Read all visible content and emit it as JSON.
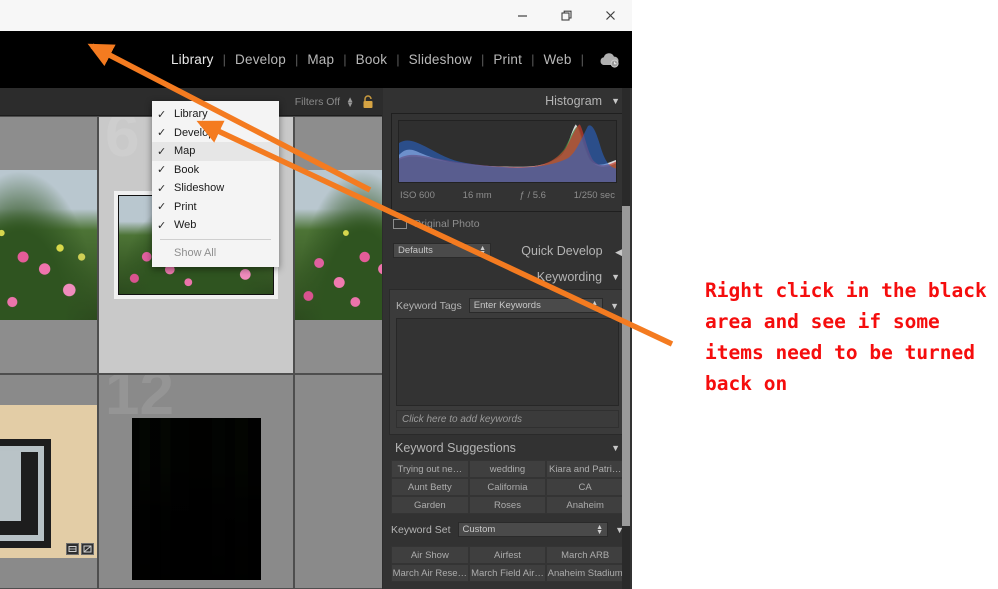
{
  "titlebar": {
    "minimize_label": "Minimize",
    "restore_label": "Restore",
    "close_label": "Close"
  },
  "module_bar": {
    "cloud_icon": "cloud-sync-icon",
    "modules": [
      {
        "label": "Library",
        "active": true
      },
      {
        "label": "Develop",
        "active": false
      },
      {
        "label": "Map",
        "active": false
      },
      {
        "label": "Book",
        "active": false
      },
      {
        "label": "Slideshow",
        "active": false
      },
      {
        "label": "Print",
        "active": false
      },
      {
        "label": "Web",
        "active": false
      }
    ]
  },
  "filter_bar": {
    "filters_label": "Filters Off",
    "stepper_icon": "updown-stepper-icon",
    "lock_icon": "lock-icon"
  },
  "grid": {
    "cell_numbers": [
      "6",
      "12"
    ],
    "thumbnails": [
      {
        "name": "roses-left-partial"
      },
      {
        "name": "roses-selected"
      },
      {
        "name": "roses-right-partial"
      },
      {
        "name": "framed-art-tan-wall"
      },
      {
        "name": "dark-porch-window"
      }
    ],
    "badge_icons": [
      "crop-badge-icon",
      "develop-badge-icon"
    ]
  },
  "context_menu": {
    "items": [
      {
        "label": "Library",
        "checked": true,
        "highlighted": false,
        "disabled": false
      },
      {
        "label": "Develop",
        "checked": true,
        "highlighted": false,
        "disabled": false
      },
      {
        "label": "Map",
        "checked": true,
        "highlighted": true,
        "disabled": false
      },
      {
        "label": "Book",
        "checked": true,
        "highlighted": false,
        "disabled": false
      },
      {
        "label": "Slideshow",
        "checked": true,
        "highlighted": false,
        "disabled": false
      },
      {
        "label": "Print",
        "checked": true,
        "highlighted": false,
        "disabled": false
      },
      {
        "label": "Web",
        "checked": true,
        "highlighted": false,
        "disabled": false
      }
    ],
    "show_all_label": "Show All",
    "check_glyph": "✓"
  },
  "panels": {
    "histogram": {
      "title": "Histogram",
      "collapse_icon": "triangle-down-icon",
      "iso": "ISO 600",
      "focal_length": "16 mm",
      "aperture": "ƒ / 5.6",
      "shutter": "1/250 sec",
      "original_photo_label": "Original Photo",
      "original_photo_icon": "photo-frame-icon"
    },
    "quick_develop": {
      "title": "Quick Develop",
      "collapse_icon": "triangle-left-icon",
      "preset_value": "Defaults",
      "stepper_icon": "updown-stepper-icon"
    },
    "keywording": {
      "title": "Keywording",
      "collapse_icon": "triangle-down-icon",
      "tags_label": "Keyword Tags",
      "tags_value": "Enter Keywords",
      "tags_stepper_icon": "updown-stepper-icon",
      "tags_chevron_icon": "triangle-down-icon",
      "add_placeholder": "Click here to add keywords"
    },
    "keyword_suggestions": {
      "title": "Keyword Suggestions",
      "collapse_icon": "triangle-down-icon",
      "suggestions": [
        "Trying out ne…",
        "wedding",
        "Kiara and Patri…",
        "Aunt Betty",
        "California",
        "CA",
        "Garden",
        "Roses",
        "Anaheim"
      ]
    },
    "keyword_set": {
      "title": "Keyword Set",
      "collapse_icon": "triangle-down-icon",
      "set_value": "Custom",
      "set_stepper_icon": "updown-stepper-icon",
      "set_chevron_icon": "triangle-down-icon",
      "keywords": [
        "Air Show",
        "Airfest",
        "March ARB",
        "March Air Rese…",
        "March Field Air…",
        "Anaheim Stadium"
      ]
    },
    "scrollbar_name": "right-panel-scrollbar"
  },
  "annotation": {
    "text": "Right click in the black area and see if some items need to be turned back on",
    "color": "#f50d0d",
    "arrow_color": "#f47b20",
    "arrows": [
      {
        "name": "arrow-to-black-area"
      },
      {
        "name": "arrow-to-map-menu-item"
      }
    ]
  }
}
